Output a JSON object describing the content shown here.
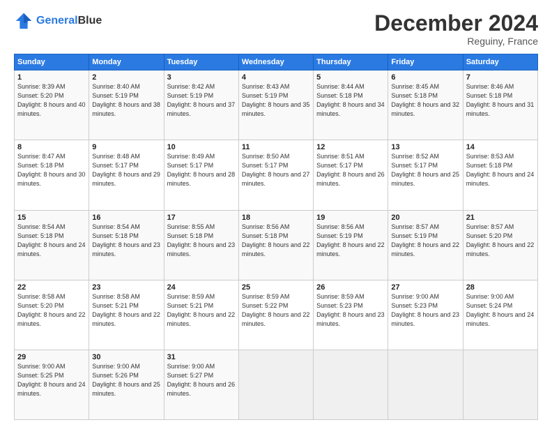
{
  "header": {
    "logo_line1": "General",
    "logo_line2": "Blue",
    "month": "December 2024",
    "location": "Reguiny, France"
  },
  "weekdays": [
    "Sunday",
    "Monday",
    "Tuesday",
    "Wednesday",
    "Thursday",
    "Friday",
    "Saturday"
  ],
  "weeks": [
    [
      {
        "day": "1",
        "sunrise": "8:39 AM",
        "sunset": "5:20 PM",
        "daylight": "8 hours and 40 minutes."
      },
      {
        "day": "2",
        "sunrise": "8:40 AM",
        "sunset": "5:19 PM",
        "daylight": "8 hours and 38 minutes."
      },
      {
        "day": "3",
        "sunrise": "8:42 AM",
        "sunset": "5:19 PM",
        "daylight": "8 hours and 37 minutes."
      },
      {
        "day": "4",
        "sunrise": "8:43 AM",
        "sunset": "5:19 PM",
        "daylight": "8 hours and 35 minutes."
      },
      {
        "day": "5",
        "sunrise": "8:44 AM",
        "sunset": "5:18 PM",
        "daylight": "8 hours and 34 minutes."
      },
      {
        "day": "6",
        "sunrise": "8:45 AM",
        "sunset": "5:18 PM",
        "daylight": "8 hours and 32 minutes."
      },
      {
        "day": "7",
        "sunrise": "8:46 AM",
        "sunset": "5:18 PM",
        "daylight": "8 hours and 31 minutes."
      }
    ],
    [
      {
        "day": "8",
        "sunrise": "8:47 AM",
        "sunset": "5:18 PM",
        "daylight": "8 hours and 30 minutes."
      },
      {
        "day": "9",
        "sunrise": "8:48 AM",
        "sunset": "5:17 PM",
        "daylight": "8 hours and 29 minutes."
      },
      {
        "day": "10",
        "sunrise": "8:49 AM",
        "sunset": "5:17 PM",
        "daylight": "8 hours and 28 minutes."
      },
      {
        "day": "11",
        "sunrise": "8:50 AM",
        "sunset": "5:17 PM",
        "daylight": "8 hours and 27 minutes."
      },
      {
        "day": "12",
        "sunrise": "8:51 AM",
        "sunset": "5:17 PM",
        "daylight": "8 hours and 26 minutes."
      },
      {
        "day": "13",
        "sunrise": "8:52 AM",
        "sunset": "5:17 PM",
        "daylight": "8 hours and 25 minutes."
      },
      {
        "day": "14",
        "sunrise": "8:53 AM",
        "sunset": "5:18 PM",
        "daylight": "8 hours and 24 minutes."
      }
    ],
    [
      {
        "day": "15",
        "sunrise": "8:54 AM",
        "sunset": "5:18 PM",
        "daylight": "8 hours and 24 minutes."
      },
      {
        "day": "16",
        "sunrise": "8:54 AM",
        "sunset": "5:18 PM",
        "daylight": "8 hours and 23 minutes."
      },
      {
        "day": "17",
        "sunrise": "8:55 AM",
        "sunset": "5:18 PM",
        "daylight": "8 hours and 23 minutes."
      },
      {
        "day": "18",
        "sunrise": "8:56 AM",
        "sunset": "5:18 PM",
        "daylight": "8 hours and 22 minutes."
      },
      {
        "day": "19",
        "sunrise": "8:56 AM",
        "sunset": "5:19 PM",
        "daylight": "8 hours and 22 minutes."
      },
      {
        "day": "20",
        "sunrise": "8:57 AM",
        "sunset": "5:19 PM",
        "daylight": "8 hours and 22 minutes."
      },
      {
        "day": "21",
        "sunrise": "8:57 AM",
        "sunset": "5:20 PM",
        "daylight": "8 hours and 22 minutes."
      }
    ],
    [
      {
        "day": "22",
        "sunrise": "8:58 AM",
        "sunset": "5:20 PM",
        "daylight": "8 hours and 22 minutes."
      },
      {
        "day": "23",
        "sunrise": "8:58 AM",
        "sunset": "5:21 PM",
        "daylight": "8 hours and 22 minutes."
      },
      {
        "day": "24",
        "sunrise": "8:59 AM",
        "sunset": "5:21 PM",
        "daylight": "8 hours and 22 minutes."
      },
      {
        "day": "25",
        "sunrise": "8:59 AM",
        "sunset": "5:22 PM",
        "daylight": "8 hours and 22 minutes."
      },
      {
        "day": "26",
        "sunrise": "8:59 AM",
        "sunset": "5:23 PM",
        "daylight": "8 hours and 23 minutes."
      },
      {
        "day": "27",
        "sunrise": "9:00 AM",
        "sunset": "5:23 PM",
        "daylight": "8 hours and 23 minutes."
      },
      {
        "day": "28",
        "sunrise": "9:00 AM",
        "sunset": "5:24 PM",
        "daylight": "8 hours and 24 minutes."
      }
    ],
    [
      {
        "day": "29",
        "sunrise": "9:00 AM",
        "sunset": "5:25 PM",
        "daylight": "8 hours and 24 minutes."
      },
      {
        "day": "30",
        "sunrise": "9:00 AM",
        "sunset": "5:26 PM",
        "daylight": "8 hours and 25 minutes."
      },
      {
        "day": "31",
        "sunrise": "9:00 AM",
        "sunset": "5:27 PM",
        "daylight": "8 hours and 26 minutes."
      },
      null,
      null,
      null,
      null
    ]
  ]
}
